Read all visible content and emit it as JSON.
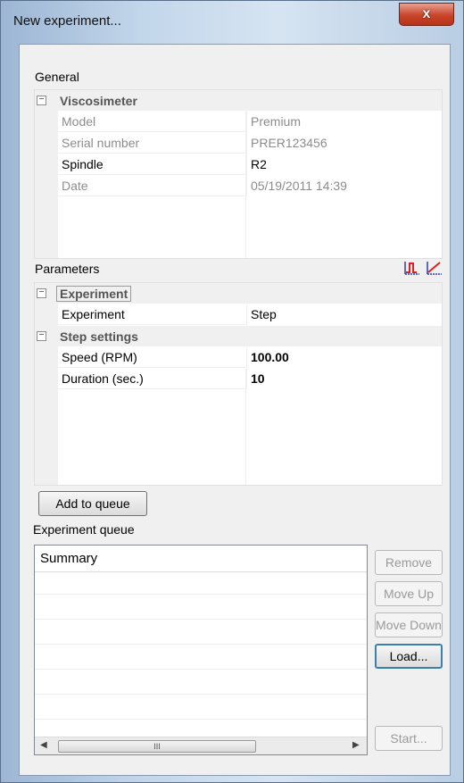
{
  "window": {
    "title": "New experiment...",
    "close_label": "x"
  },
  "general": {
    "section_label": "General",
    "category": "Viscosimeter",
    "rows": [
      {
        "name": "Model",
        "value": "Premium",
        "readonly": true
      },
      {
        "name": "Serial number",
        "value": "PRER123456",
        "readonly": true
      },
      {
        "name": "Spindle",
        "value": "R2",
        "readonly": false
      },
      {
        "name": "Date",
        "value": "05/19/2011 14:39",
        "readonly": true
      }
    ]
  },
  "parameters": {
    "section_label": "Parameters",
    "icons": [
      "step-chart-icon",
      "ramp-chart-icon"
    ],
    "experiment_category": "Experiment",
    "experiment_row": {
      "name": "Experiment",
      "value": "Step"
    },
    "step_category": "Step settings",
    "step_rows": [
      {
        "name": "Speed (RPM)",
        "value": "100.00"
      },
      {
        "name": "Duration (sec.)",
        "value": "10"
      }
    ]
  },
  "buttons": {
    "add_to_queue": "Add to queue",
    "remove": "Remove",
    "move_up": "Move Up",
    "move_down": "Move Down",
    "load": "Load...",
    "start": "Start..."
  },
  "queue": {
    "section_label": "Experiment queue",
    "column_header": "Summary",
    "scroll_grip": "III"
  },
  "colors": {
    "accent_red": "#e02020",
    "accent_blue": "#2a3fb0",
    "focus_border": "#3c7fb1"
  }
}
